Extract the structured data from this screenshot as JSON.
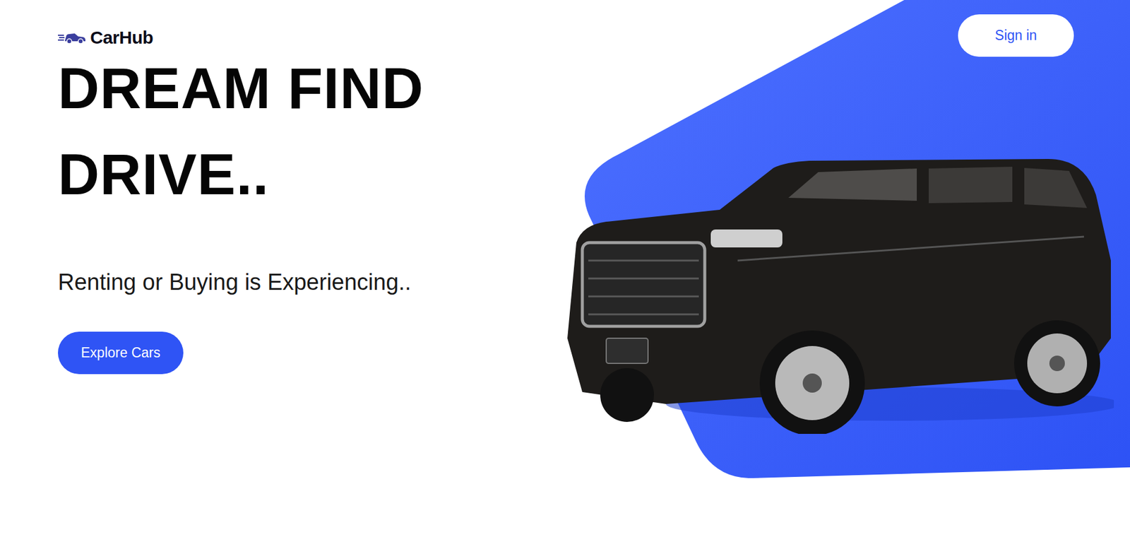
{
  "brand": {
    "name": "CarHub"
  },
  "nav": {
    "sign_in": "Sign in"
  },
  "hero": {
    "headline": [
      "DREAM FIND",
      "DRIVE.."
    ],
    "subtitle": "Renting or Buying is Experiencing..",
    "cta": "Explore Cars"
  }
}
